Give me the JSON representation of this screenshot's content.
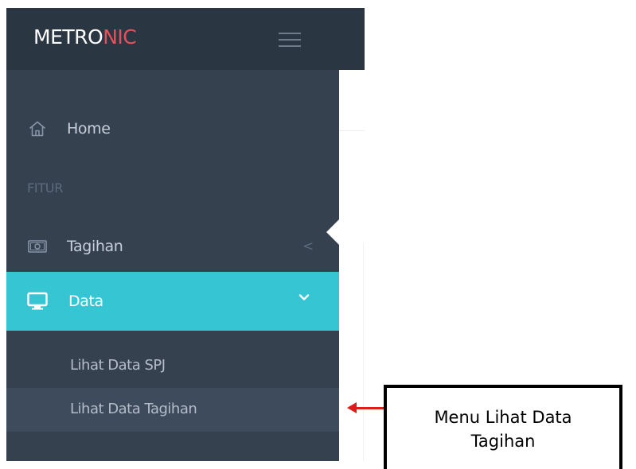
{
  "header": {
    "logo_part1": "METRO",
    "logo_part2": "NIC",
    "menu_icon": "hamburger-icon"
  },
  "sidebar": {
    "items": [
      {
        "label": "Home",
        "icon": "home-icon"
      }
    ],
    "section_heading": "FITUR",
    "groups": [
      {
        "label": "Tagihan",
        "icon": "money-icon",
        "chevron": "<",
        "expanded": false
      },
      {
        "label": "Data",
        "icon": "monitor-icon",
        "chevron": "chevron-down-icon",
        "expanded": true,
        "active": true
      }
    ],
    "sub_items": [
      {
        "label": "Lihat Data SPJ"
      },
      {
        "label": "Lihat Data Tagihan",
        "selected": true
      }
    ]
  },
  "annotation": {
    "line1": "Menu Lihat Data",
    "line2": "Tagihan"
  },
  "colors": {
    "header_bg": "#2b3643",
    "sidebar_bg": "#364150",
    "active_bg": "#36c6d3",
    "logo_accent": "#e7505a",
    "arrow": "#e01b1b"
  }
}
